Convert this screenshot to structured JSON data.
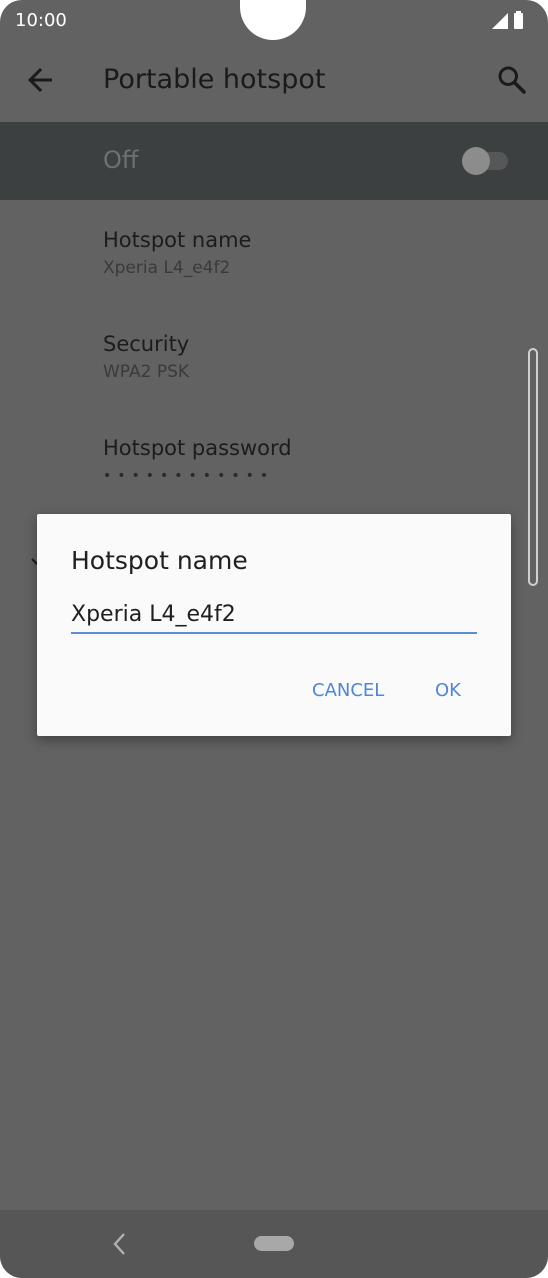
{
  "status_bar": {
    "time": "10:00"
  },
  "app_bar": {
    "title": "Portable hotspot"
  },
  "master_switch": {
    "label": "Off",
    "enabled": false
  },
  "settings": {
    "hotspot_name": {
      "title": "Hotspot name",
      "value": "Xperia L4_e4f2"
    },
    "security": {
      "title": "Security",
      "value": "WPA2 PSK"
    },
    "password": {
      "title": "Hotspot password",
      "masked_value": "••••••••••••"
    }
  },
  "dialog": {
    "title": "Hotspot name",
    "input_value": "Xperia L4_e4f2",
    "cancel_label": "CANCEL",
    "ok_label": "OK"
  },
  "colors": {
    "accent": "#4f86d6",
    "scrim_background": "#626262",
    "dialog_background": "#fafafa"
  },
  "icons": [
    "arrow-back-icon",
    "search-icon",
    "signal-icon",
    "battery-icon",
    "chevron-down-icon",
    "nav-back-icon",
    "nav-home-pill"
  ]
}
